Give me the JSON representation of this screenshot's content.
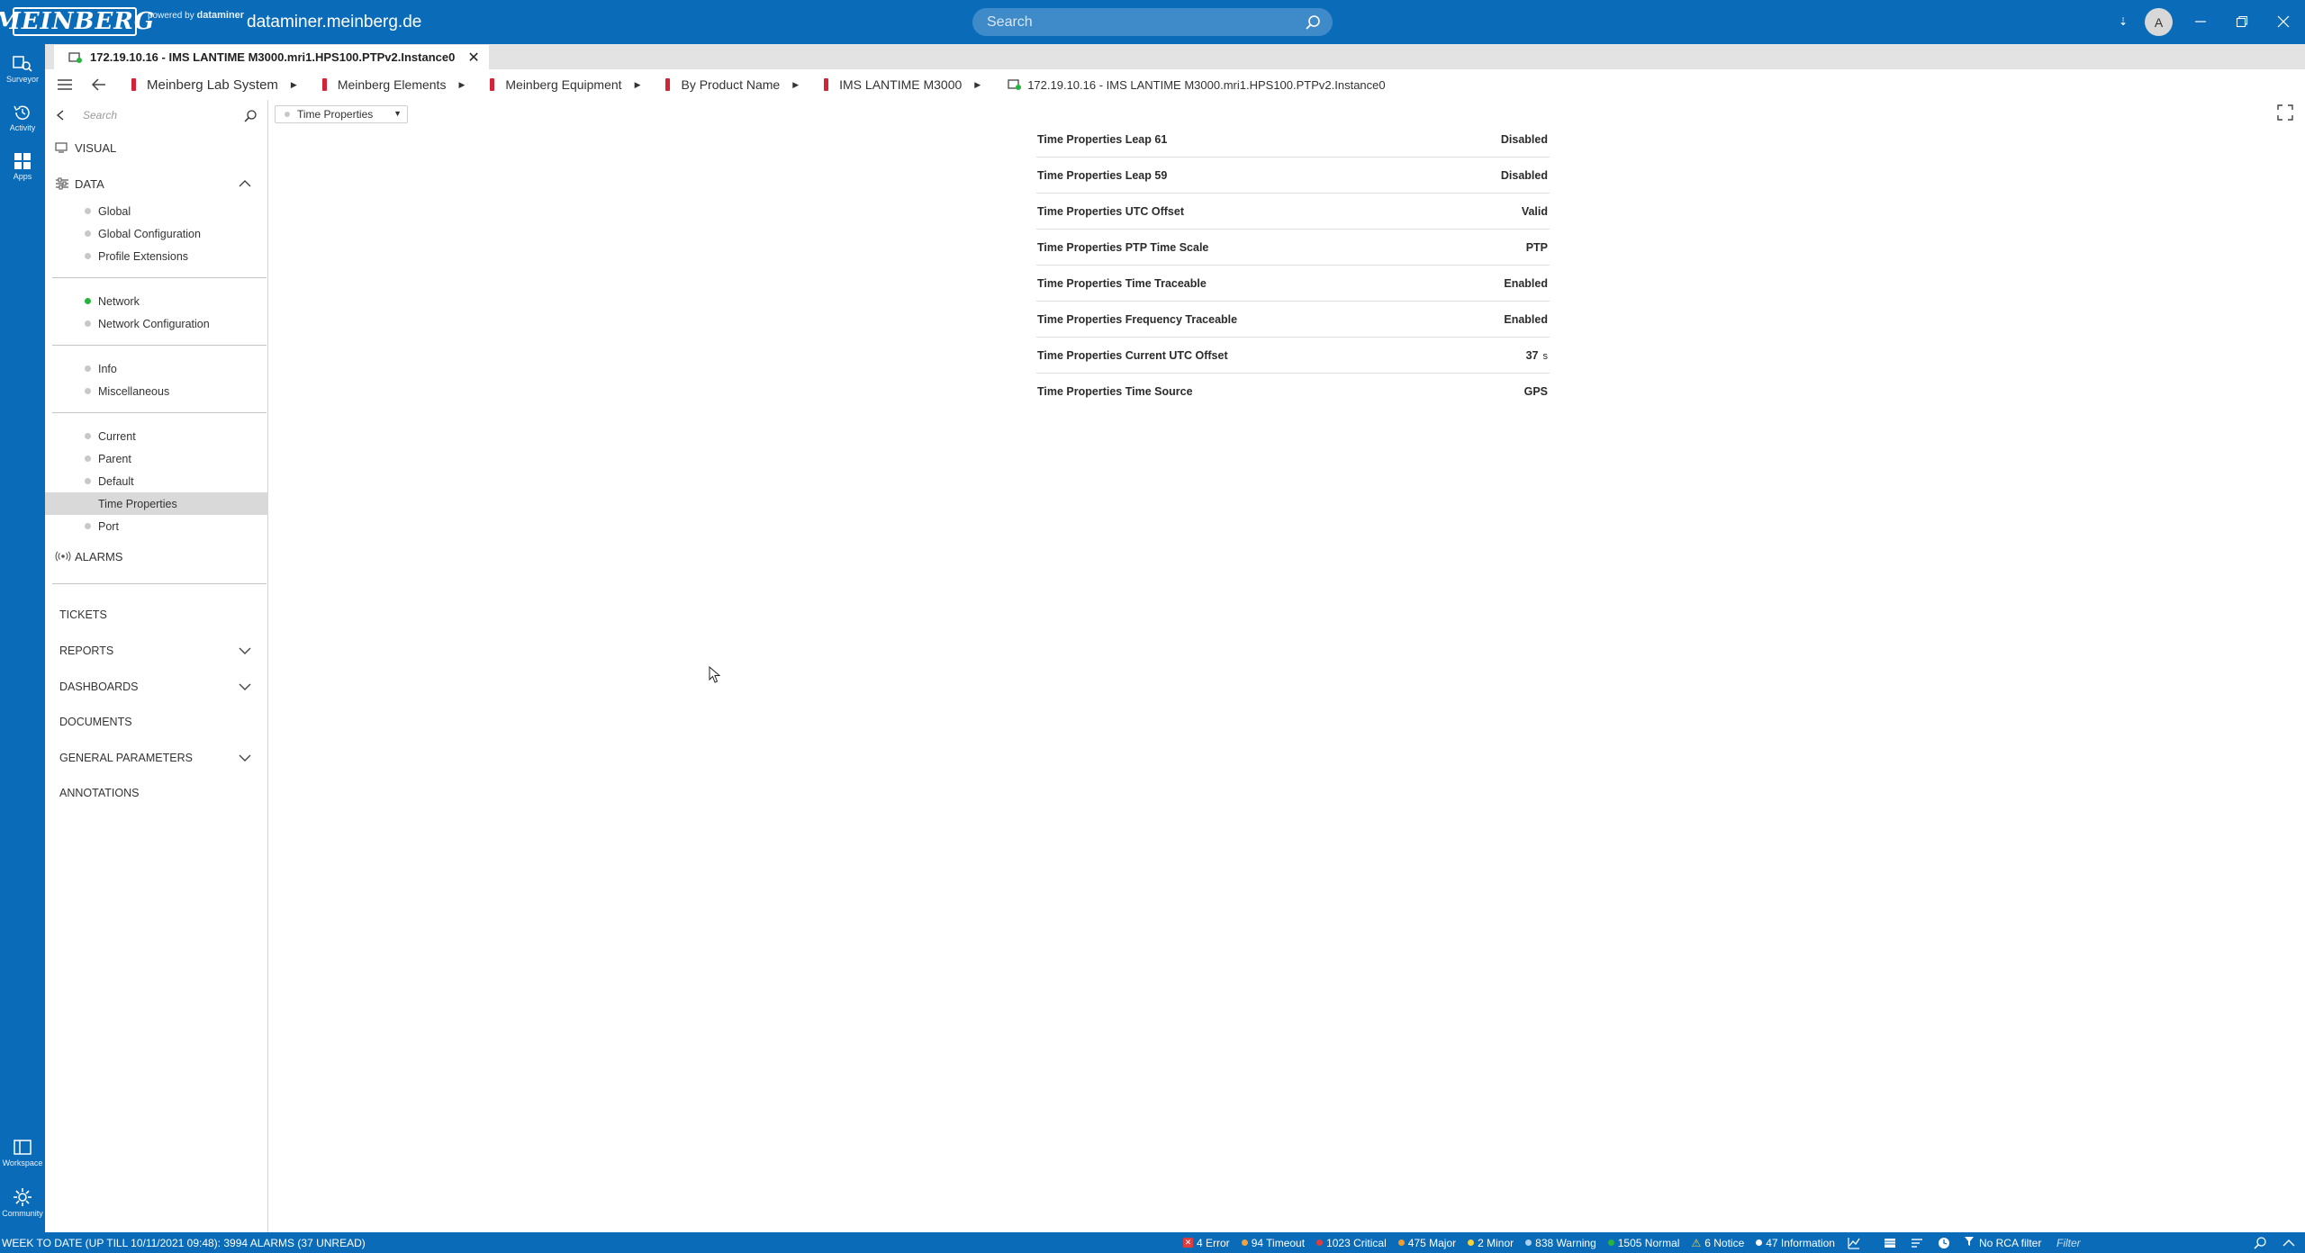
{
  "app": {
    "logo_text": "MEINBERG",
    "powered_by": "powered by",
    "powered_brand": "dataminer",
    "host": "dataminer.meinberg.de",
    "search_placeholder": "Search",
    "avatar_initial": "A"
  },
  "rail": [
    {
      "label": "Surveyor",
      "icon": "surveyor-icon"
    },
    {
      "label": "Activity",
      "icon": "activity-icon"
    },
    {
      "label": "Apps",
      "icon": "apps-icon"
    },
    {
      "label": "Workspace",
      "icon": "workspace-icon"
    },
    {
      "label": "Community",
      "icon": "community-icon"
    }
  ],
  "tab": {
    "title": "172.19.10.16 - IMS LANTIME M3000.mri1.HPS100.PTPv2.Instance0"
  },
  "breadcrumb": [
    "Meinberg Lab System",
    "Meinberg Elements",
    "Meinberg Equipment",
    "By Product Name",
    "IMS LANTIME M3000",
    "172.19.10.16 - IMS LANTIME M3000.mri1.HPS100.PTPv2.Instance0"
  ],
  "sidebar": {
    "search_placeholder": "Search",
    "visual": "VISUAL",
    "data": "DATA",
    "groups": [
      [
        "Global",
        "Global Configuration",
        "Profile Extensions"
      ],
      [
        "Network",
        "Network Configuration"
      ],
      [
        "Info",
        "Miscellaneous"
      ],
      [
        "Current",
        "Parent",
        "Default",
        "Time Properties",
        "Port"
      ]
    ],
    "alarms": "ALARMS",
    "tickets": "TICKETS",
    "reports": "REPORTS",
    "dashboards": "DASHBOARDS",
    "documents": "DOCUMENTS",
    "general_parameters": "GENERAL PARAMETERS",
    "annotations": "ANNOTATIONS"
  },
  "page": {
    "selected": "Time Properties"
  },
  "params": [
    {
      "label": "Time Properties Leap 61",
      "value": "Disabled",
      "unit": ""
    },
    {
      "label": "Time Properties Leap 59",
      "value": "Disabled",
      "unit": ""
    },
    {
      "label": "Time Properties UTC Offset",
      "value": "Valid",
      "unit": ""
    },
    {
      "label": "Time Properties PTP Time Scale",
      "value": "PTP",
      "unit": ""
    },
    {
      "label": "Time Properties Time Traceable",
      "value": "Enabled",
      "unit": ""
    },
    {
      "label": "Time Properties Frequency Traceable",
      "value": "Enabled",
      "unit": ""
    },
    {
      "label": "Time Properties Current UTC Offset",
      "value": "37",
      "unit": "s"
    },
    {
      "label": "Time Properties Time Source",
      "value": "GPS",
      "unit": ""
    }
  ],
  "status": {
    "left": "WEEK TO DATE (UP TILL 10/11/2021 09:48): 3994 ALARMS (37 UNREAD)",
    "error": "4 Error",
    "timeout": "94 Timeout",
    "critical": "1023 Critical",
    "major": "475 Major",
    "minor": "2 Minor",
    "warning": "838 Warning",
    "normal": "1505 Normal",
    "notice": "6 Notice",
    "information": "47 Information",
    "rca": "No RCA filter",
    "filter_placeholder": "Filter"
  },
  "colors": {
    "brand": "#0a6bb8",
    "element_red": "#d32338",
    "normal_green": "#27b43d"
  }
}
